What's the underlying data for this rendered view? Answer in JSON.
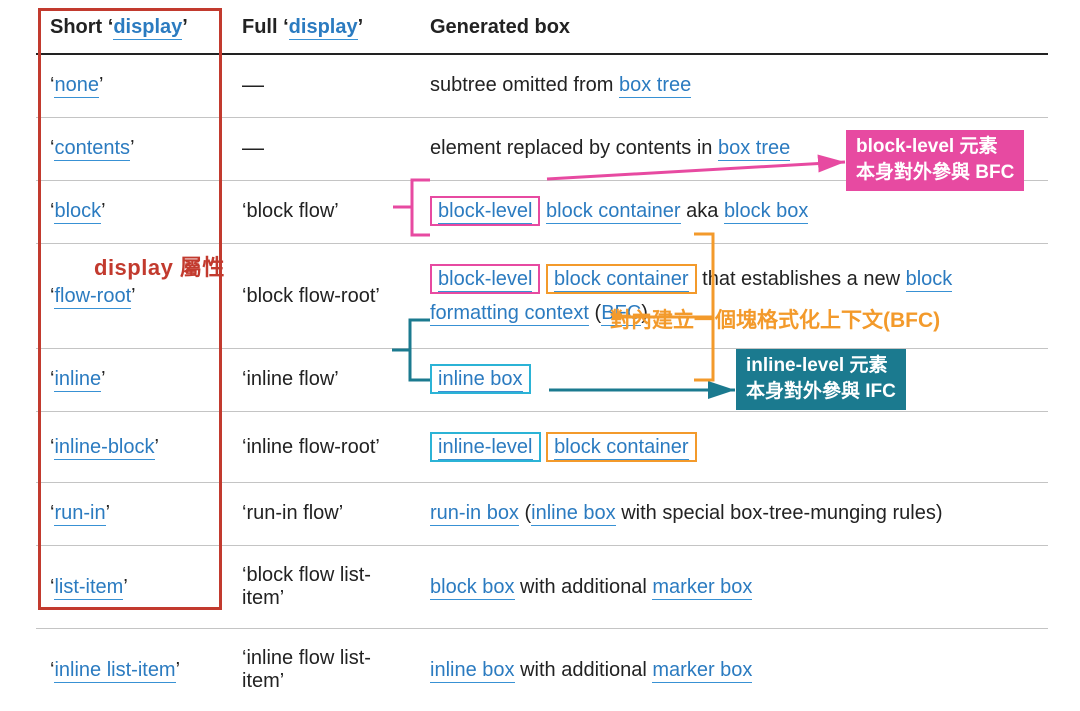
{
  "headers": {
    "short": "Short ",
    "short_link": "display",
    "full": "Full ",
    "full_link": "display",
    "gen": "Generated box"
  },
  "rows": [
    {
      "short": "none",
      "full": "—",
      "gen": {
        "pre": "subtree omitted from ",
        "link": "box tree"
      }
    },
    {
      "short": "contents",
      "full": "—",
      "gen": {
        "pre": "element replaced by contents in ",
        "link": "box tree"
      }
    },
    {
      "short": "block",
      "full": "block flow",
      "gen": {
        "hl1": "block-level",
        "mid": " ",
        "link1": "block container",
        "post": " aka ",
        "link2": "block box"
      }
    },
    {
      "short": "flow-root",
      "full": "block flow-root",
      "gen": {
        "hl1": "block-level",
        "hl2": "block container",
        "mid": " that establishes a new ",
        "link1": "block formatting context",
        "paren": "BFC"
      }
    },
    {
      "short": "inline",
      "full": "inline flow",
      "gen": {
        "hl1": "inline box"
      }
    },
    {
      "short": "inline-block",
      "full": "inline flow-root",
      "gen": {
        "hl1": "inline-level",
        "hl2": "block container"
      }
    },
    {
      "short": "run-in",
      "full": "run-in flow",
      "gen": {
        "link1": "run-in box",
        "mid": " (",
        "link2": "inline box",
        "post": " with special box-tree-munging rules)"
      }
    },
    {
      "short": "list-item",
      "full": "block flow list-item",
      "gen": {
        "link1": "block box",
        "mid": " with additional ",
        "link2": "marker box"
      }
    },
    {
      "short": "inline list-item",
      "full": "inline flow list-item",
      "gen": {
        "link1": "inline box",
        "mid": " with additional ",
        "link2": "marker box"
      }
    }
  ],
  "labels": {
    "display": "display 屬性",
    "orange": "對內建立一個塊格式化上下文(BFC)",
    "pink_badge": {
      "l1": "block-level 元素",
      "l2": "本身對外參與 BFC"
    },
    "teal_badge": {
      "l1": "inline-level 元素",
      "l2": "本身對外參與 IFC"
    }
  }
}
